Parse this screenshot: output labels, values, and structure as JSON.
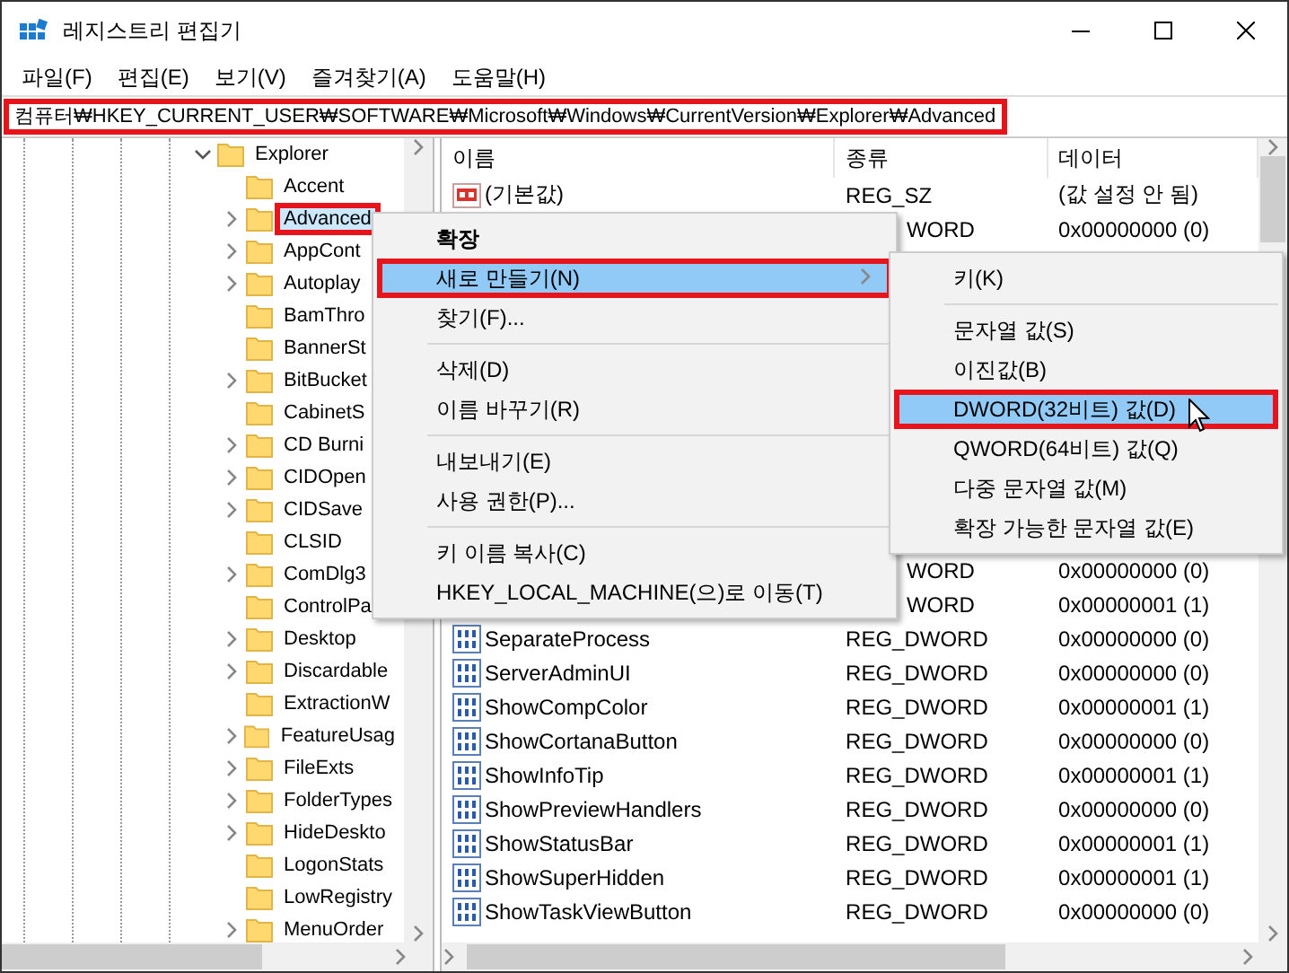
{
  "window": {
    "title": "레지스트리 편집기"
  },
  "menu_bar": [
    "파일(F)",
    "편집(E)",
    "보기(V)",
    "즐겨찾기(A)",
    "도움말(H)"
  ],
  "address": {
    "value": "컴퓨터₩HKEY_CURRENT_USER₩SOFTWARE₩Microsoft₩Windows₩CurrentVersion₩Explorer₩Advanced",
    "highlighted": true
  },
  "tree": {
    "items": [
      {
        "label": "Explorer",
        "expandable": true,
        "expanded": true,
        "selected": false,
        "highlighted": false,
        "children": [
          {
            "label": "Accent",
            "expandable": false,
            "selected": false,
            "highlighted": false
          },
          {
            "label": "Advanced",
            "expandable": true,
            "selected": true,
            "highlighted": true
          },
          {
            "label": "AppCont",
            "expandable": true,
            "selected": false,
            "highlighted": false
          },
          {
            "label": "Autoplay",
            "expandable": true,
            "selected": false,
            "highlighted": false
          },
          {
            "label": "BamThro",
            "expandable": false,
            "selected": false,
            "highlighted": false
          },
          {
            "label": "BannerSt",
            "expandable": false,
            "selected": false,
            "highlighted": false
          },
          {
            "label": "BitBucket",
            "expandable": true,
            "selected": false,
            "highlighted": false
          },
          {
            "label": "CabinetS",
            "expandable": false,
            "selected": false,
            "highlighted": false
          },
          {
            "label": "CD Burni",
            "expandable": true,
            "selected": false,
            "highlighted": false
          },
          {
            "label": "CIDOpen",
            "expandable": true,
            "selected": false,
            "highlighted": false
          },
          {
            "label": "CIDSave",
            "expandable": true,
            "selected": false,
            "highlighted": false
          },
          {
            "label": "CLSID",
            "expandable": false,
            "selected": false,
            "highlighted": false
          },
          {
            "label": "ComDlg3",
            "expandable": true,
            "selected": false,
            "highlighted": false
          },
          {
            "label": "ControlPa",
            "expandable": false,
            "selected": false,
            "highlighted": false
          },
          {
            "label": "Desktop",
            "expandable": true,
            "selected": false,
            "highlighted": false
          },
          {
            "label": "Discardable",
            "expandable": true,
            "selected": false,
            "highlighted": false
          },
          {
            "label": "ExtractionW",
            "expandable": false,
            "selected": false,
            "highlighted": false
          },
          {
            "label": "FeatureUsag",
            "expandable": true,
            "selected": false,
            "highlighted": false
          },
          {
            "label": "FileExts",
            "expandable": true,
            "selected": false,
            "highlighted": false
          },
          {
            "label": "FolderTypes",
            "expandable": true,
            "selected": false,
            "highlighted": false
          },
          {
            "label": "HideDeskto",
            "expandable": true,
            "selected": false,
            "highlighted": false
          },
          {
            "label": "LogonStats",
            "expandable": false,
            "selected": false,
            "highlighted": false
          },
          {
            "label": "LowRegistry",
            "expandable": false,
            "selected": false,
            "highlighted": false
          },
          {
            "label": "MenuOrder",
            "expandable": true,
            "selected": false,
            "highlighted": false
          }
        ]
      }
    ]
  },
  "list": {
    "columns": [
      "이름",
      "종류",
      "데이터"
    ],
    "rows": [
      {
        "kind": "string",
        "name": "(기본값)",
        "type": "REG_SZ",
        "data": "(값 설정 안 됨)"
      },
      {
        "kind": "covered_type",
        "type": "WORD",
        "data": "0x00000000 (0)"
      },
      {
        "kind": "covered"
      },
      {
        "kind": "covered"
      },
      {
        "kind": "covered"
      },
      {
        "kind": "covered"
      },
      {
        "kind": "covered"
      },
      {
        "kind": "covered"
      },
      {
        "kind": "covered"
      },
      {
        "kind": "covered"
      },
      {
        "kind": "covered"
      },
      {
        "kind": "covered_type",
        "type": "WORD",
        "data": "0x00000000 (0)"
      },
      {
        "kind": "covered_type",
        "type": "WORD",
        "data": "0x00000001 (1)"
      },
      {
        "kind": "dword",
        "name": "SeparateProcess",
        "type": "REG_DWORD",
        "data": "0x00000000 (0)"
      },
      {
        "kind": "dword",
        "name": "ServerAdminUI",
        "type": "REG_DWORD",
        "data": "0x00000000 (0)"
      },
      {
        "kind": "dword",
        "name": "ShowCompColor",
        "type": "REG_DWORD",
        "data": "0x00000001 (1)"
      },
      {
        "kind": "dword",
        "name": "ShowCortanaButton",
        "type": "REG_DWORD",
        "data": "0x00000000 (0)"
      },
      {
        "kind": "dword",
        "name": "ShowInfoTip",
        "type": "REG_DWORD",
        "data": "0x00000001 (1)"
      },
      {
        "kind": "dword",
        "name": "ShowPreviewHandlers",
        "type": "REG_DWORD",
        "data": "0x00000000 (0)"
      },
      {
        "kind": "dword",
        "name": "ShowStatusBar",
        "type": "REG_DWORD",
        "data": "0x00000001 (1)"
      },
      {
        "kind": "dword",
        "name": "ShowSuperHidden",
        "type": "REG_DWORD",
        "data": "0x00000001 (1)"
      },
      {
        "kind": "dword",
        "name": "ShowTaskViewButton",
        "type": "REG_DWORD",
        "data": "0x00000000 (0)"
      }
    ]
  },
  "context_menu": {
    "items": [
      {
        "kind": "default",
        "label": "확장",
        "selected": false,
        "highlighted": false
      },
      {
        "kind": "submenu",
        "label": "새로 만들기(N)",
        "selected": true,
        "highlighted": true
      },
      {
        "kind": "item",
        "label": "찾기(F)...",
        "selected": false,
        "highlighted": false
      },
      {
        "kind": "separator"
      },
      {
        "kind": "item",
        "label": "삭제(D)",
        "selected": false,
        "highlighted": false
      },
      {
        "kind": "item",
        "label": "이름 바꾸기(R)",
        "selected": false,
        "highlighted": false
      },
      {
        "kind": "separator"
      },
      {
        "kind": "item",
        "label": "내보내기(E)",
        "selected": false,
        "highlighted": false
      },
      {
        "kind": "item",
        "label": "사용 권한(P)...",
        "selected": false,
        "highlighted": false
      },
      {
        "kind": "separator"
      },
      {
        "kind": "item",
        "label": "키 이름 복사(C)",
        "selected": false,
        "highlighted": false
      },
      {
        "kind": "item",
        "label": "HKEY_LOCAL_MACHINE(으)로 이동(T)",
        "selected": false,
        "highlighted": false
      }
    ]
  },
  "submenu": {
    "items": [
      {
        "kind": "item",
        "label": "키(K)",
        "selected": false,
        "highlighted": false
      },
      {
        "kind": "separator"
      },
      {
        "kind": "item",
        "label": "문자열 값(S)",
        "selected": false,
        "highlighted": false
      },
      {
        "kind": "item",
        "label": "이진값(B)",
        "selected": false,
        "highlighted": false
      },
      {
        "kind": "item",
        "label": "DWORD(32비트) 값(D)",
        "selected": true,
        "highlighted": true
      },
      {
        "kind": "item",
        "label": "QWORD(64비트) 값(Q)",
        "selected": false,
        "highlighted": false
      },
      {
        "kind": "item",
        "label": "다중 문자열 값(M)",
        "selected": false,
        "highlighted": false
      },
      {
        "kind": "item",
        "label": "확장 가능한 문자열 값(E)",
        "selected": false,
        "highlighted": false
      }
    ]
  }
}
